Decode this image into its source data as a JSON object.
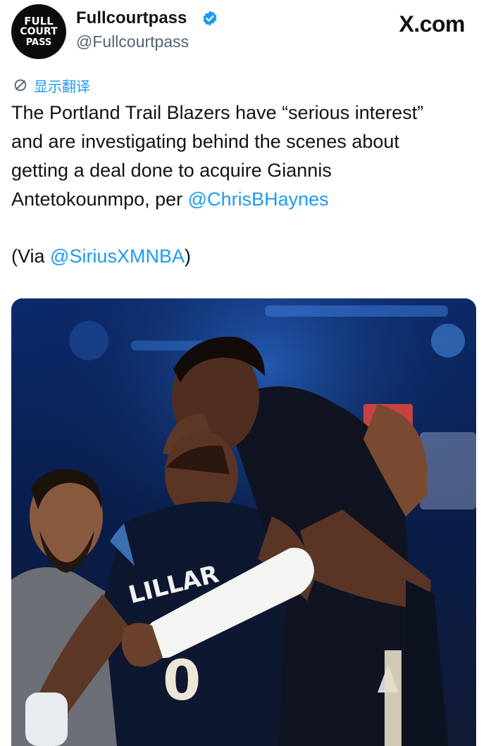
{
  "header": {
    "avatar_text": [
      "FULL",
      "COURT",
      "PASS"
    ],
    "display_name": "Fullcourtpass",
    "handle": "@Fullcourtpass",
    "verified_icon": "verified-badge-icon",
    "brand": "X.com"
  },
  "translate": {
    "icon": "translate-icon",
    "label": "显示翻译"
  },
  "tweet": {
    "line1": "The Portland Trail Blazers have “serious interest”",
    "line2": "and are investigating behind the scenes about",
    "line3": "getting a deal done to acquire Giannis",
    "line4_prefix": "Antetokounmpo, per ",
    "mention1": "@ChrisBHaynes",
    "via_prefix": "(Via ",
    "mention2": "@SiriusXMNBA",
    "via_suffix": ")"
  },
  "media": {
    "jersey_name": "LILLAR",
    "jersey_number": "0"
  },
  "colors": {
    "link": "#1d9bf0",
    "text": "#0f1419",
    "secondary": "#536471"
  }
}
